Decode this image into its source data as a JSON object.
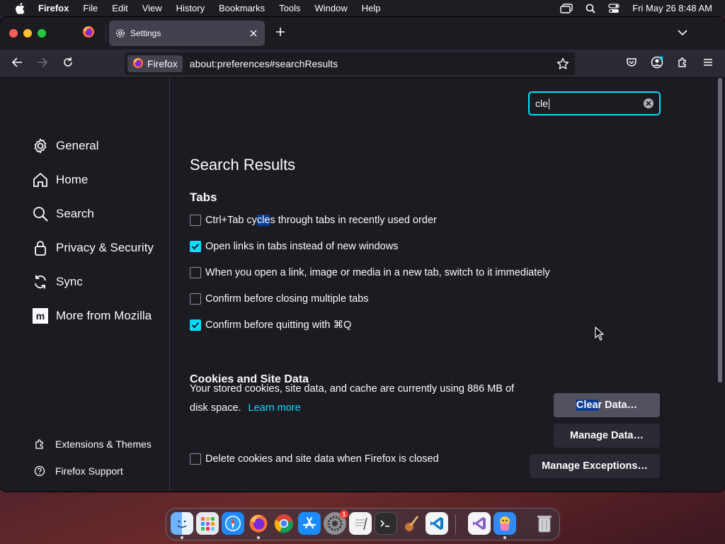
{
  "menubar": {
    "app_name": "Firefox",
    "items": [
      "File",
      "Edit",
      "View",
      "History",
      "Bookmarks",
      "Tools",
      "Window",
      "Help"
    ],
    "clock": "Fri May 26  8:48 AM"
  },
  "tabs": {
    "active_title": "Settings"
  },
  "navbar": {
    "identity_label": "Firefox",
    "url": "about:preferences#searchResults"
  },
  "sidebar": {
    "categories": [
      {
        "label": "General",
        "icon": "gear-icon"
      },
      {
        "label": "Home",
        "icon": "home-icon"
      },
      {
        "label": "Search",
        "icon": "search-icon"
      },
      {
        "label": "Privacy & Security",
        "icon": "lock-icon"
      },
      {
        "label": "Sync",
        "icon": "sync-icon"
      },
      {
        "label": "More from Mozilla",
        "icon": "mozilla-icon"
      }
    ],
    "footer": [
      {
        "label": "Extensions & Themes",
        "icon": "puzzle-icon"
      },
      {
        "label": "Firefox Support",
        "icon": "help-icon"
      }
    ]
  },
  "search": {
    "value": "cle"
  },
  "main": {
    "title": "Search Results",
    "tabs_section": {
      "heading": "Tabs",
      "options": [
        {
          "pre": "Ctrl+Tab cy",
          "hl": "cle",
          "post": "s through tabs in recently used order",
          "checked": false
        },
        {
          "pre": "Open links in tabs instead of new windows",
          "hl": "",
          "post": "",
          "checked": true
        },
        {
          "pre": "When you open a link, image or media in a new tab, switch to it immediately",
          "hl": "",
          "post": "",
          "checked": false
        },
        {
          "pre": "Confirm before closing multiple tabs",
          "hl": "",
          "post": "",
          "checked": false
        },
        {
          "pre": "Confirm before quitting with ⌘Q",
          "hl": "",
          "post": "",
          "checked": true
        }
      ]
    },
    "cookies_section": {
      "heading": "Cookies and Site Data",
      "description": "Your stored cookies, site data, and cache are currently using 886 MB of disk space.",
      "learn_more": "Learn more",
      "clear_button_hl": "Clea",
      "clear_button_rest": "r Data…",
      "manage_data": "Manage Data…",
      "manage_exceptions": "Manage Exceptions…",
      "delete_option": "Delete cookies and site data when Firefox is closed",
      "delete_checked": false
    }
  },
  "dock": {
    "apps": [
      "Finder",
      "Launchpad",
      "Safari",
      "Firefox",
      "Chrome",
      "App Store",
      "System Settings",
      "TextEdit",
      "Terminal",
      "Instruments",
      "VS Code",
      "Visual Studio",
      "Preview Character",
      "Trash"
    ],
    "settings_badge": "1"
  },
  "colors": {
    "accent": "#00ddff",
    "background": "#1c1b22",
    "toolbar": "#2b2a33",
    "text": "#fbfbfe"
  }
}
